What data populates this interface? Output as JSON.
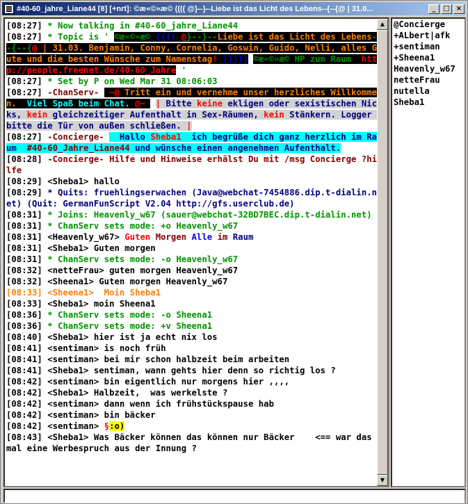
{
  "window": {
    "title": "#40-60_jahre_Liane44 [8] [+nrt]:  ©æ«©»æ© ((((  @}--}--Liebe ist das Licht des Lebens--{--{@ | 31.0...",
    "buttons": {
      "minimize": "_",
      "maximize": "□",
      "close": "×"
    }
  },
  "log": [
    {
      "segs": [
        [
          "ts",
          "[08:27] "
        ],
        [
          "green",
          "* Now talking in #40-60_jahre_Liane44"
        ]
      ]
    },
    {
      "segs": [
        [
          "ts",
          "[08:27] "
        ],
        [
          "green",
          "* Topic is ' "
        ],
        [
          "blackbg green",
          "©æ«©»æ©"
        ],
        [
          "blackbg blue",
          " (((( "
        ],
        [
          "blackbg red",
          "@"
        ],
        [
          "blackbg green",
          "}--}--"
        ],
        [
          "blackbg orange",
          "Liebe ist das Licht des Lebens"
        ],
        [
          "blackbg green",
          "--{--{"
        ],
        [
          "blackbg red",
          "@"
        ],
        [
          "blackbg orange",
          " | 31.03. Benjamin, Conny, Cornelia, Goswin, Guido, Nelli, alles Gute und die besten Wünsche zum Namenstag"
        ],
        [
          "blackbg red",
          "!"
        ],
        [
          "blackbg blue",
          " )))))"
        ],
        [
          "ts",
          " "
        ],
        [
          "blackbg green",
          "©æ«©»æ©"
        ],
        [
          "blackbg green",
          " HP zum Raum  "
        ],
        [
          "blackbg red",
          "http://people.freenet.de/40-60_Jahre"
        ],
        [
          "green",
          " '"
        ]
      ]
    },
    {
      "segs": [
        [
          "ts",
          "[08:27] "
        ],
        [
          "green",
          "* Set by P on Wed Mar 31 08:06:03"
        ]
      ]
    },
    {
      "segs": [
        [
          "ts",
          "[08:27] "
        ],
        [
          "dkred",
          "-ChanServ- "
        ],
        [
          "blackbg red",
          " ~@ "
        ],
        [
          "blackbg orange",
          "Tritt ein und vernehme unser herzliches Willkommen.  "
        ],
        [
          "blackbg cyan",
          "Viel Spaß beim Chat."
        ],
        [
          "blackbg red",
          " @~ "
        ],
        [
          "ts",
          " "
        ],
        [
          "greybg red",
          "| "
        ],
        [
          "greybg navy",
          "Bitte "
        ],
        [
          "greybg red",
          "keine"
        ],
        [
          "greybg navy",
          " ekligen oder sexistischen Nicks, "
        ],
        [
          "greybg red",
          "kein"
        ],
        [
          "greybg navy",
          " gleichzeitiger Aufenthalt in Sex-Räumen, "
        ],
        [
          "greybg red",
          "kein"
        ],
        [
          "greybg navy",
          " Stänkern. Logger bitte die Tür von außen schließen. "
        ],
        [
          "greybg red",
          "|"
        ]
      ]
    },
    {
      "segs": [
        [
          "ts",
          "[08:27] "
        ],
        [
          "dkred",
          "-Concierge- "
        ],
        [
          "cyanbg navy",
          "  Hallo "
        ],
        [
          "cyanbg red",
          "Sheba1"
        ],
        [
          "cyanbg navy",
          "  ich begrüße dich ganz herzlich im Raum  "
        ],
        [
          "cyanbg dkred",
          "#40-60_Jahre_Liane44"
        ],
        [
          "cyanbg navy",
          " und wünsche einen angenehmen Aufenthalt."
        ]
      ]
    },
    {
      "segs": [
        [
          "ts",
          "[08:28] "
        ],
        [
          "dkred",
          "-Concierge- Hilfe und Hinweise erhälst Du mit /msg Concierge ?hilfe"
        ]
      ]
    },
    {
      "segs": [
        [
          "ts",
          "[08:29] <Sheba1> hallo"
        ]
      ]
    },
    {
      "segs": [
        [
          "ts",
          "[08:29] "
        ],
        [
          "navy",
          "* Quits: fruehlingserwachen (Java@webchat-7454886.dip.t-dialin.net) (Quit: GermanFunScript V2.04 http://gfs.userclub.de)"
        ]
      ]
    },
    {
      "segs": [
        [
          "ts",
          "[08:31] "
        ],
        [
          "green",
          "* Joins: Heavenly_w67 (sauer@webchat-32BD7BEC.dip.t-dialin.net)"
        ]
      ]
    },
    {
      "segs": [
        [
          "ts",
          "[08:31] "
        ],
        [
          "green",
          "* ChanServ sets mode: +o Heavenly_w67"
        ]
      ]
    },
    {
      "segs": [
        [
          "ts",
          "[08:31] <Heavenly_w67> "
        ],
        [
          "red",
          "Guten "
        ],
        [
          "dkred",
          "Morgen "
        ],
        [
          "blue",
          "Alle "
        ],
        [
          "dkred",
          "im "
        ],
        [
          "navy",
          "Raum"
        ]
      ]
    },
    {
      "segs": [
        [
          "ts",
          "[08:31] <Sheba1> Guten morgen"
        ]
      ]
    },
    {
      "segs": [
        [
          "ts",
          "[08:31] "
        ],
        [
          "green",
          "* ChanServ sets mode: -o Heavenly_w67"
        ]
      ]
    },
    {
      "segs": [
        [
          "ts",
          "[08:32] <netteFrau> guten morgen Heavenly_w67"
        ]
      ]
    },
    {
      "segs": [
        [
          "ts",
          "[08:32] <Sheena1> Guten morgen Heavenly_w67"
        ]
      ]
    },
    {
      "segs": [
        [
          "orange",
          "[08:33] <Sheena1>  Moin Sheba1"
        ]
      ]
    },
    {
      "segs": [
        [
          "ts",
          "[08:33] <Sheba1> moin Sheena1"
        ]
      ]
    },
    {
      "segs": [
        [
          "ts",
          "[08:36] "
        ],
        [
          "green",
          "* ChanServ sets mode: -o Sheena1"
        ]
      ]
    },
    {
      "segs": [
        [
          "ts",
          "[08:36] "
        ],
        [
          "green",
          "* ChanServ sets mode: +v Sheena1"
        ]
      ]
    },
    {
      "segs": [
        [
          "ts",
          "[08:40] <Sheba1> hier ist ja echt nix los"
        ]
      ]
    },
    {
      "segs": [
        [
          "ts",
          "[08:41] <sentiman> is noch früh"
        ]
      ]
    },
    {
      "segs": [
        [
          "ts",
          "[08:41] <sentiman> bei mir schon halbzeit beim arbeiten"
        ]
      ]
    },
    {
      "segs": [
        [
          "ts",
          "[08:41] <Sheba1> sentiman, wann gehts hier denn so richtig los ?"
        ]
      ]
    },
    {
      "segs": [
        [
          "ts",
          "[08:42] <sentiman> bin eigentlich nur morgens hier ,,,,"
        ]
      ]
    },
    {
      "segs": [
        [
          "ts",
          "[08:42] <Sheba1> Halbzeit,  was werkelste ?"
        ]
      ]
    },
    {
      "segs": [
        [
          "ts",
          "[08:42] <sentiman> dann wenn ich frühstückspause hab"
        ]
      ]
    },
    {
      "segs": [
        [
          "ts",
          "[08:42] <sentiman> bin bäcker"
        ]
      ]
    },
    {
      "segs": [
        [
          "ts",
          "[08:42] <sentiman> "
        ],
        [
          "red",
          "§"
        ],
        [
          "yellowbg ts",
          ":o)"
        ]
      ]
    },
    {
      "segs": [
        [
          "ts",
          "[08:43] <Sheba1> Was Bäcker können das können nur Bäcker    <== war das mal eine Werbespruch aus der Innung ?"
        ]
      ]
    }
  ],
  "nicklist": [
    "@Concierge",
    "+ALbert|afk",
    "+sentiman",
    "+Sheena1",
    "Heavenly_w67",
    "netteFrau",
    "nutella",
    "Sheba1"
  ],
  "scrollbar": {
    "up": "▲",
    "down": "▼"
  },
  "input": {
    "value": ""
  }
}
